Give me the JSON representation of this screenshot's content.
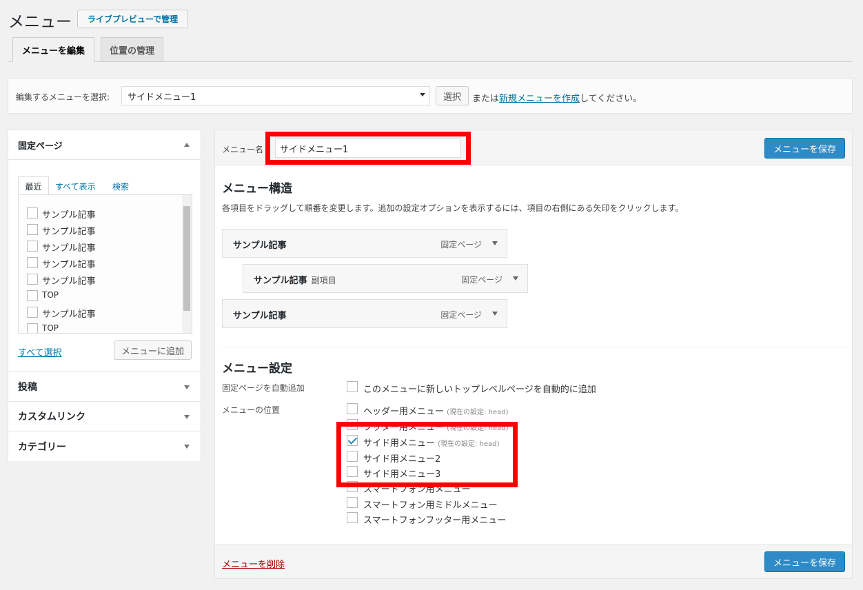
{
  "header": {
    "title": "メニュー",
    "live_preview_button": "ライブプレビューで管理"
  },
  "tabs": [
    {
      "label": "メニューを編集",
      "active": true
    },
    {
      "label": "位置の管理",
      "active": false
    }
  ],
  "select_menu": {
    "label": "編集するメニューを選択:",
    "selected": "サイドメニュー1",
    "select_button": "選択",
    "or_text": "または",
    "create_link": "新規メニューを作成",
    "suffix_text": "してください。"
  },
  "sidebar": {
    "pages_title": "固定ページ",
    "tabs": [
      "最近",
      "すべて表示",
      "検索"
    ],
    "items": [
      "サンプル記事",
      "サンプル記事",
      "サンプル記事",
      "サンプル記事",
      "サンプル記事",
      "TOP",
      "サンプル記事",
      "TOP"
    ],
    "select_all": "すべて選択",
    "add_to_menu": "メニューに追加",
    "sections": [
      "投稿",
      "カスタムリンク",
      "カテゴリー"
    ]
  },
  "editor": {
    "menu_name_label": "メニュー名",
    "menu_name_value": "サイドメニュー1",
    "save_button": "メニューを保存",
    "structure_title": "メニュー構造",
    "structure_help": "各項目をドラッグして順番を変更します。追加の設定オプションを表示するには、項目の右側にある矢印をクリックします。",
    "menu_items": [
      {
        "title": "サンプル記事",
        "sub": "",
        "type": "固定ページ",
        "level": 0
      },
      {
        "title": "サンプル記事",
        "sub": "副項目",
        "type": "固定ページ",
        "level": 1
      },
      {
        "title": "サンプル記事",
        "sub": "",
        "type": "固定ページ",
        "level": 0
      }
    ],
    "settings_title": "メニュー設定",
    "auto_add_label": "固定ページを自動追加",
    "auto_add_option": "このメニューに新しいトップレベルページを自動的に追加",
    "location_label": "メニューの位置",
    "locations": [
      {
        "label": "ヘッダー用メニュー",
        "note": "(現在の設定: head)",
        "checked": false
      },
      {
        "label": "フッター用メニュー",
        "note": "(現在の設定: head)",
        "checked": false
      },
      {
        "label": "サイド用メニュー",
        "note": "(現在の設定: head)",
        "checked": true
      },
      {
        "label": "サイド用メニュー2",
        "note": "",
        "checked": false
      },
      {
        "label": "サイド用メニュー3",
        "note": "",
        "checked": false
      },
      {
        "label": "スマートフォン用メニュー",
        "note": "",
        "checked": false
      },
      {
        "label": "スマートフォン用ミドルメニュー",
        "note": "",
        "checked": false
      },
      {
        "label": "スマートフォンフッター用メニュー",
        "note": "",
        "checked": false
      }
    ],
    "delete_link": "メニューを削除"
  },
  "colors": {
    "accent": "#0073aa",
    "primary_button": "#2e8bc7",
    "highlight": "#ff0000",
    "delete": "#a00"
  }
}
